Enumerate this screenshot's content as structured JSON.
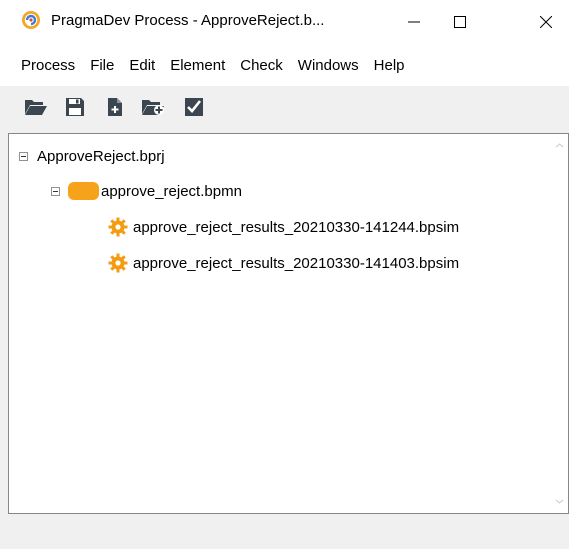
{
  "window": {
    "title": "PragmaDev Process - ApproveReject.b...",
    "minimize_symbol": "—",
    "maximize_symbol": "☐",
    "close_symbol": "✕"
  },
  "menu": {
    "items": [
      "Process",
      "File",
      "Edit",
      "Element",
      "Check",
      "Windows",
      "Help"
    ]
  },
  "toolbar": {
    "buttons": [
      {
        "icon": "open-folder-icon"
      },
      {
        "icon": "save-icon"
      },
      {
        "icon": "new-file-icon"
      },
      {
        "icon": "add-folder-icon"
      },
      {
        "icon": "check-icon"
      }
    ]
  },
  "tree": {
    "project": {
      "label": "ApproveReject.bprj",
      "icon": "project-node"
    },
    "process": {
      "label": "approve_reject.bpmn",
      "icon": "bpmn-process-icon"
    },
    "results": [
      {
        "label": "approve_reject_results_20210330-141244.bpsim",
        "icon": "simulation-gear-icon"
      },
      {
        "label": "approve_reject_results_20210330-141403.bpsim",
        "icon": "simulation-gear-icon"
      }
    ]
  },
  "colors": {
    "accent_orange": "#f7a21b",
    "gear_orange": "#f39c12",
    "toolbar_icon_gray": "#3c4650"
  }
}
